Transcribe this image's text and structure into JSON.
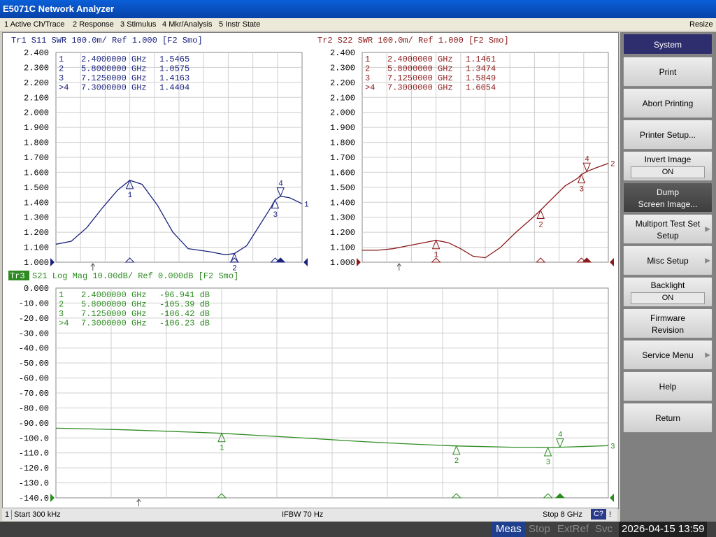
{
  "window": {
    "title": "E5071C Network Analyzer"
  },
  "menu": [
    {
      "num": "1",
      "label": "Active Ch/Trace"
    },
    {
      "num": "2",
      "label": "Response"
    },
    {
      "num": "3",
      "label": "Stimulus"
    },
    {
      "num": "4",
      "label": "Mkr/Analysis"
    },
    {
      "num": "5",
      "label": "Instr State"
    }
  ],
  "menu_resize": "Resize",
  "traces": {
    "tr1": {
      "header": "Tr1 S11 SWR 100.0m/ Ref 1.000 [F2 Smo]",
      "color": "#1a237e",
      "y_ticks": [
        "2.400",
        "2.300",
        "2.200",
        "2.100",
        "2.000",
        "1.900",
        "1.800",
        "1.700",
        "1.600",
        "1.500",
        "1.400",
        "1.300",
        "1.200",
        "1.100",
        "1.000"
      ],
      "markers": [
        {
          "id": "1",
          "freq": "2.4000000 GHz",
          "value": "1.5465"
        },
        {
          "id": "2",
          "freq": "5.8000000 GHz",
          "value": "1.0575"
        },
        {
          "id": "3",
          "freq": "7.1250000 GHz",
          "value": "1.4163"
        },
        {
          "id": ">4",
          "freq": "7.3000000 GHz",
          "value": "1.4404"
        }
      ]
    },
    "tr2": {
      "header": "Tr2 S22 SWR 100.0m/ Ref 1.000 [F2 Smo]",
      "color": "#8b1a1a",
      "y_ticks": [
        "2.400",
        "2.300",
        "2.200",
        "2.100",
        "2.000",
        "1.900",
        "1.800",
        "1.700",
        "1.600",
        "1.500",
        "1.400",
        "1.300",
        "1.200",
        "1.100",
        "1.000"
      ],
      "markers": [
        {
          "id": "1",
          "freq": "2.4000000 GHz",
          "value": "1.1461"
        },
        {
          "id": "2",
          "freq": "5.8000000 GHz",
          "value": "1.3474"
        },
        {
          "id": "3",
          "freq": "7.1250000 GHz",
          "value": "1.5849"
        },
        {
          "id": ">4",
          "freq": "7.3000000 GHz",
          "value": "1.6054"
        }
      ]
    },
    "tr3": {
      "header_tag": "Tr3",
      "header": "S21 Log Mag 10.00dB/ Ref 0.000dB [F2 Smo]",
      "color": "#2e8b22",
      "y_ticks": [
        "0.000",
        "-10.00",
        "-20.00",
        "-30.00",
        "-40.00",
        "-50.00",
        "-60.00",
        "-70.00",
        "-80.00",
        "-90.00",
        "-100.0",
        "-110.0",
        "-120.0",
        "-130.0",
        "-140.0"
      ],
      "markers": [
        {
          "id": "1",
          "freq": "2.4000000 GHz",
          "value": "-96.941 dB"
        },
        {
          "id": "2",
          "freq": "5.8000000 GHz",
          "value": "-105.39 dB"
        },
        {
          "id": "3",
          "freq": "7.1250000 GHz",
          "value": "-106.42 dB"
        },
        {
          "id": ">4",
          "freq": "7.3000000 GHz",
          "value": "-106.23 dB"
        }
      ]
    }
  },
  "chart_data": [
    {
      "type": "line",
      "title": "Tr1 S11 SWR 100.0m/ Ref 1.000 [F2 Smo]",
      "xlabel": "",
      "ylabel": "",
      "xlim_ghz": [
        0.0003,
        8
      ],
      "ylim": [
        1.0,
        2.4
      ],
      "series": [
        {
          "name": "Tr1",
          "x": [
            0.0003,
            0.5,
            1.0,
            1.5,
            2.0,
            2.4,
            2.8,
            3.3,
            3.8,
            4.3,
            5.0,
            5.5,
            5.8,
            6.2,
            6.6,
            7.0,
            7.125,
            7.3,
            7.6,
            7.8,
            8.0
          ],
          "values": [
            1.12,
            1.14,
            1.23,
            1.36,
            1.48,
            1.5465,
            1.52,
            1.38,
            1.2,
            1.09,
            1.07,
            1.05,
            1.0575,
            1.11,
            1.24,
            1.37,
            1.4163,
            1.4404,
            1.43,
            1.41,
            1.39
          ]
        }
      ]
    },
    {
      "type": "line",
      "title": "Tr2 S22 SWR 100.0m/ Ref 1.000 [F2 Smo]",
      "xlabel": "",
      "ylabel": "",
      "xlim_ghz": [
        0.0003,
        8
      ],
      "ylim": [
        1.0,
        2.4
      ],
      "series": [
        {
          "name": "Tr2",
          "x": [
            0.0003,
            0.5,
            1.0,
            1.5,
            2.0,
            2.4,
            2.8,
            3.2,
            3.6,
            4.0,
            4.5,
            5.0,
            5.5,
            5.8,
            6.2,
            6.6,
            7.0,
            7.125,
            7.3,
            7.6,
            8.0
          ],
          "values": [
            1.08,
            1.08,
            1.09,
            1.11,
            1.13,
            1.1461,
            1.13,
            1.09,
            1.04,
            1.03,
            1.1,
            1.2,
            1.29,
            1.3474,
            1.43,
            1.51,
            1.56,
            1.5849,
            1.6054,
            1.63,
            1.66
          ]
        }
      ]
    },
    {
      "type": "line",
      "title": "S21 Log Mag 10.00dB/ Ref 0.000dB [F2 Smo]",
      "xlabel": "",
      "ylabel": "",
      "xlim_ghz": [
        0.0003,
        8
      ],
      "ylim": [
        -140,
        0
      ],
      "series": [
        {
          "name": "Tr3",
          "x": [
            0.0003,
            0.5,
            1.0,
            1.5,
            2.0,
            2.4,
            3.0,
            3.5,
            4.0,
            4.5,
            5.0,
            5.5,
            5.8,
            6.2,
            6.6,
            7.0,
            7.125,
            7.3,
            7.6,
            8.0
          ],
          "values": [
            -93.5,
            -94.0,
            -94.6,
            -95.4,
            -96.2,
            -96.941,
            -98.5,
            -99.8,
            -101.2,
            -102.6,
            -103.8,
            -104.8,
            -105.39,
            -105.8,
            -106.2,
            -106.3,
            -106.42,
            -106.23,
            -105.8,
            -105.2
          ]
        }
      ]
    }
  ],
  "softkeys": {
    "header": "System",
    "print": "Print",
    "abort": "Abort Printing",
    "printer_setup": "Printer Setup...",
    "invert_label": "Invert Image",
    "invert_value": "ON",
    "dump_line1": "Dump",
    "dump_line2": "Screen Image...",
    "multiport_line1": "Multiport Test Set",
    "multiport_line2": "Setup",
    "misc": "Misc Setup",
    "backlight_label": "Backlight",
    "backlight_value": "ON",
    "firmware_line1": "Firmware",
    "firmware_line2": "Revision",
    "service": "Service Menu",
    "help": "Help",
    "return": "Return"
  },
  "status": {
    "channel": "1",
    "start": "Start 300 kHz",
    "ifbw": "IFBW 70 Hz",
    "stop": "Stop 8 GHz",
    "c_flag": "C?",
    "excl": "!"
  },
  "bottom": {
    "meas": "Meas",
    "stop": "Stop",
    "extref": "ExtRef",
    "svc": "Svc",
    "datetime": "2026-04-15 13:59"
  }
}
